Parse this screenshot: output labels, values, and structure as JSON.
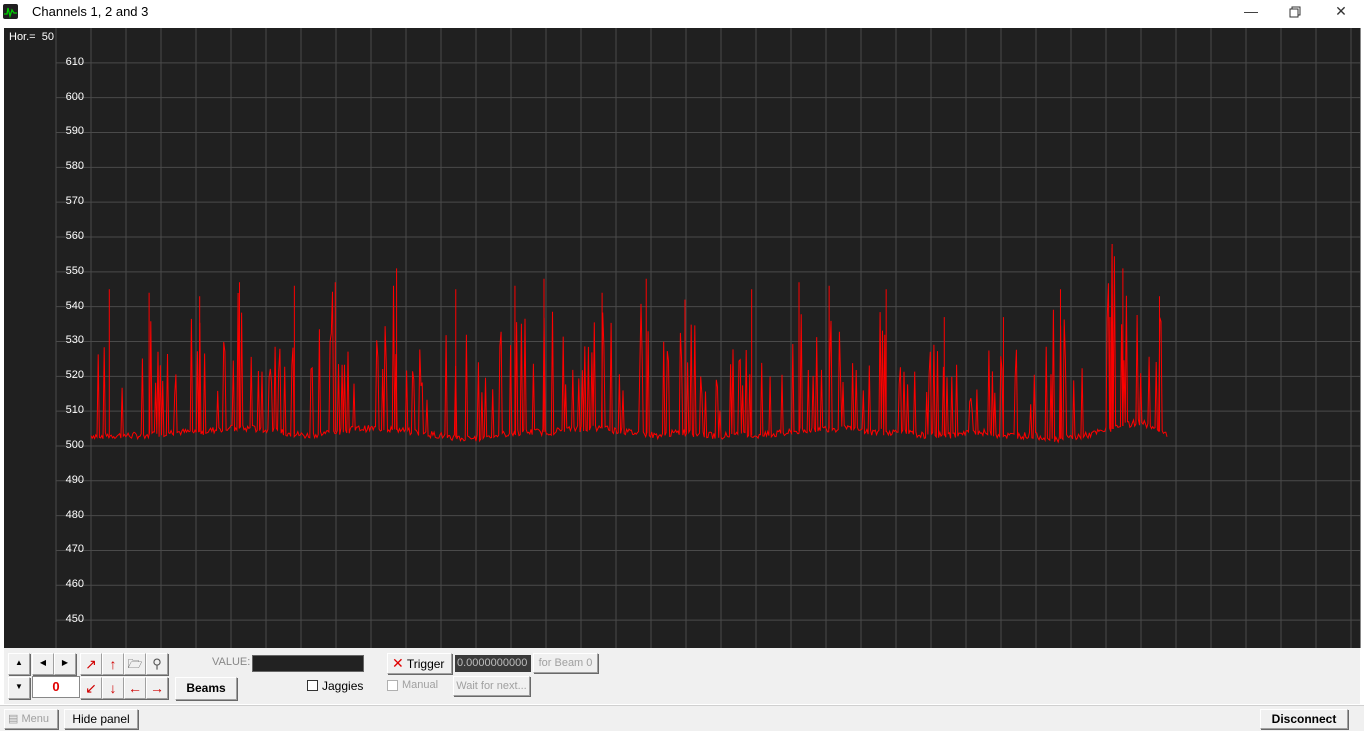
{
  "window": {
    "title": "Channels 1, 2 and 3",
    "minimize_icon": "minimize-icon",
    "restore_icon": "restore-icon",
    "close_icon": "close-icon"
  },
  "plot": {
    "hor_label": "Hor.=",
    "hor_value": "50",
    "background": "#202020",
    "grid_color": "#4a4a4a",
    "trace_color": "#ff0000"
  },
  "chart_data": {
    "type": "line",
    "ylim": [
      442,
      620
    ],
    "yticks": [
      "610",
      "600",
      "590",
      "580",
      "570",
      "560",
      "550",
      "540",
      "530",
      "520",
      "510",
      "500",
      "490",
      "480",
      "470",
      "460",
      "450"
    ],
    "x": [
      0,
      2.5,
      5,
      7.5,
      10,
      12.5,
      15,
      17.5,
      20,
      22.5,
      25,
      27.5,
      30,
      32.5,
      35,
      37.5,
      40,
      42.5,
      45,
      47.5,
      50,
      52.5,
      55,
      57.5,
      60,
      62.5,
      65,
      67.5,
      70,
      72.5,
      75,
      77.5,
      80,
      82.5,
      85,
      87.5,
      90,
      92.5,
      95,
      97.5,
      100
    ],
    "baseline": [
      503,
      503,
      503,
      504,
      504,
      505,
      505,
      504,
      503,
      504,
      505,
      505,
      504,
      503,
      502,
      503,
      504,
      504,
      505,
      505,
      504,
      503,
      504,
      503,
      503,
      503,
      504,
      505,
      505,
      504,
      504,
      503,
      503,
      504,
      503,
      503,
      502,
      503,
      505,
      507,
      503
    ],
    "peaks": [
      {
        "x": 1.7,
        "y": 545
      },
      {
        "x": 5.4,
        "y": 544
      },
      {
        "x": 10.1,
        "y": 543
      },
      {
        "x": 13.8,
        "y": 547
      },
      {
        "x": 18.9,
        "y": 546
      },
      {
        "x": 22.7,
        "y": 547
      },
      {
        "x": 28.4,
        "y": 551
      },
      {
        "x": 33.9,
        "y": 545
      },
      {
        "x": 39.4,
        "y": 546
      },
      {
        "x": 42.1,
        "y": 548
      },
      {
        "x": 47.5,
        "y": 544
      },
      {
        "x": 51.6,
        "y": 548
      },
      {
        "x": 55.2,
        "y": 542
      },
      {
        "x": 61.4,
        "y": 545
      },
      {
        "x": 65.8,
        "y": 547
      },
      {
        "x": 68.6,
        "y": 546
      },
      {
        "x": 73.9,
        "y": 545
      },
      {
        "x": 79.3,
        "y": 537
      },
      {
        "x": 84.8,
        "y": 537
      },
      {
        "x": 90.1,
        "y": 545
      },
      {
        "x": 94.7,
        "y": 537
      },
      {
        "x": 94.9,
        "y": 558
      },
      {
        "x": 95.9,
        "y": 551
      },
      {
        "x": 99.3,
        "y": 543
      }
    ],
    "x_range": [
      0,
      100
    ]
  },
  "panel": {
    "counter_value": "0",
    "beams_label": "Beams",
    "value_label": "VALUE:",
    "jaggies_label": "Jaggies",
    "trigger_label": "Trigger",
    "trigger_value": "0.0000000000",
    "for_beam_label": "for Beam 0",
    "manual_label": "Manual",
    "wait_label": "Wait for next..."
  },
  "statusbar": {
    "menu_label": "Menu",
    "hide_panel_label": "Hide panel",
    "disconnect_label": "Disconnect"
  }
}
